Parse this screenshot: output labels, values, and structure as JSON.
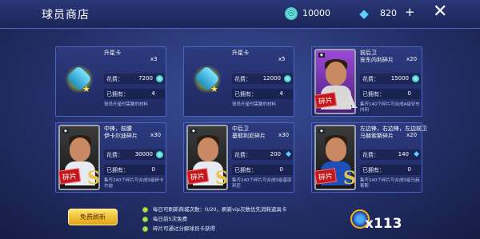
{
  "header": {
    "title": "球员商店",
    "coins": "10000",
    "gems": "820",
    "plus": "+",
    "close": "✕"
  },
  "cards": [
    {
      "name": "升星卡",
      "qty": "x3",
      "cost_label": "花费：",
      "cost": "7200",
      "currency": "coin",
      "owned_label": "已拥有：",
      "owned": "4",
      "desc": "球员升星时需要的材料",
      "tag": "",
      "rank": ""
    },
    {
      "name": "升星卡",
      "qty": "x5",
      "cost_label": "花费：",
      "cost": "12000",
      "currency": "coin",
      "owned_label": "已拥有：",
      "owned": "4",
      "desc": "球员升星时需要的材料",
      "tag": "",
      "rank": ""
    },
    {
      "name": "前后卫\n安东内利碎片",
      "qty": "x20",
      "cost_label": "花费：",
      "cost": "15000",
      "currency": "coin",
      "owned_label": "已拥有：",
      "owned": "0",
      "desc": "集齐140个碎片可合成A级安东内利",
      "tag": "碎片",
      "rank": "A"
    },
    {
      "name": "中锋，前腰\n伊卡尔迪碎片",
      "qty": "x30",
      "cost_label": "花费：",
      "cost": "30000",
      "currency": "coin",
      "owned_label": "已拥有：",
      "owned": "0",
      "desc": "集齐240个碎片可合成S级伊卡尔迪",
      "tag": "碎片",
      "rank": "S"
    },
    {
      "name": "中后卫\n基耶利尼碎片",
      "qty": "x30",
      "cost_label": "花费：",
      "cost": "200",
      "currency": "gem",
      "owned_label": "已拥有：",
      "owned": "0",
      "desc": "集齐240个碎片可合成S级基耶利尼",
      "tag": "碎片",
      "rank": "S"
    },
    {
      "name": "左边锋，右边锋，左边前卫\n马赫索斯碎片",
      "qty": "x20",
      "cost_label": "花费：",
      "cost": "140",
      "currency": "gem",
      "owned_label": "已拥有：",
      "owned": "0",
      "desc": "集齐240个碎片可合成S级马赫索斯",
      "tag": "碎片",
      "rank": "S"
    }
  ],
  "footer": {
    "free_refresh": "免费刷新",
    "lines": [
      "每日可刷新商城次数：0/20，刷新vip次数优先消耗道具卡",
      "每日前5次免费",
      "碎片可通过分解球员卡获得"
    ],
    "refresh_count": "x113"
  },
  "colors": {
    "background": "#24306a",
    "card_border": "#4d63bd",
    "accent_gold": "#e8c347",
    "fragment_red": "#c0181e"
  }
}
